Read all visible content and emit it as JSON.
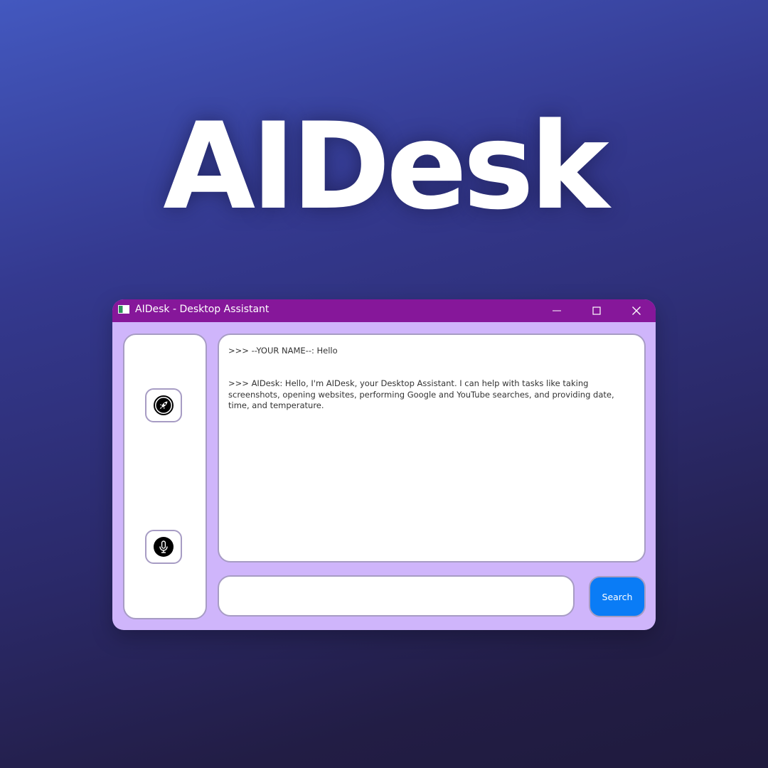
{
  "hero": {
    "title": "AIDesk"
  },
  "window": {
    "title": "AIDesk - Desktop Assistant",
    "titlebar_color": "#86179a",
    "body_color": "#cfb5fb",
    "controls": {
      "minimize_icon": "minimize-icon",
      "maximize_icon": "maximize-icon",
      "close_icon": "close-icon"
    }
  },
  "sidebar": {
    "launch_icon": "rocket-icon",
    "voice_icon": "microphone-icon"
  },
  "chat": {
    "messages": [
      ">>> --YOUR NAME--: Hello",
      ">>> AIDesk: Hello, I'm AIDesk, your Desktop Assistant. I can help with tasks like taking screenshots, opening websites, performing Google and YouTube searches, and providing date, time, and temperature."
    ]
  },
  "input": {
    "value": "",
    "placeholder": ""
  },
  "search_button": {
    "label": "Search",
    "color": "#0a7cf6"
  }
}
